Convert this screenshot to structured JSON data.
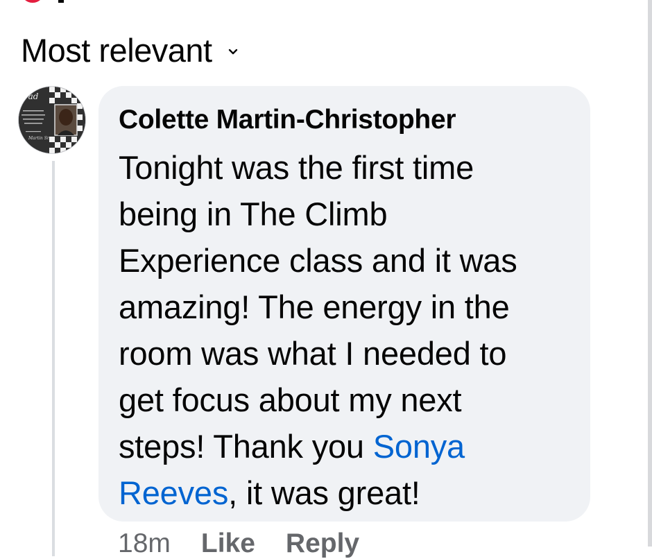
{
  "sort": {
    "label": "Most relevant",
    "icon": "chevron-down-icon"
  },
  "comment": {
    "author": "Colette Martin-Christopher",
    "avatar_icon": "profile-photo-avatar",
    "lines": [
      "Tonight was the first time",
      "being in The Climb",
      "Experience class and it was",
      "amazing! The energy in the",
      "room was what I needed to",
      "get focus about my next"
    ],
    "line7_prefix": "steps! Thank you ",
    "mention_part1": "Sonya",
    "mention_part2": "Reeves",
    "line8_suffix": ", it was great!",
    "timestamp": "18m",
    "like_label": "Like",
    "reply_label": "Reply"
  },
  "colors": {
    "bubble_bg": "#f0f2f5",
    "mention_link": "#0064d1",
    "text_primary": "#050505",
    "text_secondary": "#65676b",
    "notification_red": "#e41e3f"
  }
}
